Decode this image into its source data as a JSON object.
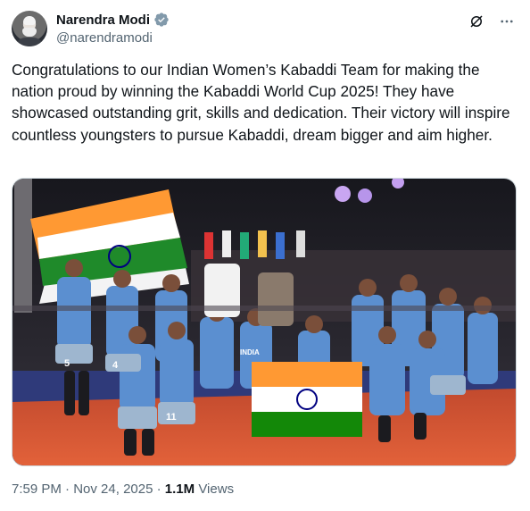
{
  "author": {
    "name": "Narendra Modi",
    "handle": "@narendramodi",
    "avatar_icon": "profile-photo",
    "verified_icon": "verified-badge-icon",
    "verified_color": "#1d9bf0"
  },
  "actions": {
    "grok_icon": "grok-icon",
    "more_icon": "more-options-icon"
  },
  "tweet": {
    "text": "Congratulations to our Indian Women’s Kabaddi Team for making the nation proud by winning the Kabaddi World Cup 2025! They have showcased outstanding grit, skills and dedication. Their victory will inspire countless youngsters to pursue Kabaddi, dream bigger and aim higher."
  },
  "media": {
    "flag_colors": {
      "saffron": "#ff9933",
      "white": "#ffffff",
      "green": "#138808",
      "chakra": "#000080"
    },
    "jersey_numbers": [
      "5",
      "4",
      "11"
    ],
    "jersey_text": "INDIA"
  },
  "footer": {
    "time": "7:59 PM",
    "separator": "·",
    "date": "Nov 24, 2025",
    "views_count": "1.1M",
    "views_label": "Views"
  }
}
